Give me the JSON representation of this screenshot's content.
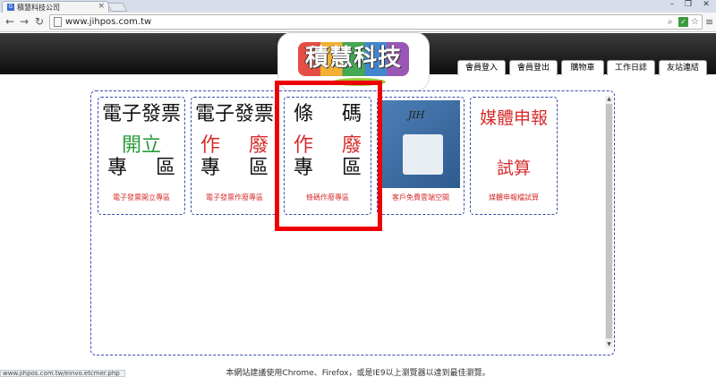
{
  "browser": {
    "tab_title": "積慧科技公司",
    "favicon": "G",
    "url": "www.jihpos.com.tw",
    "status_url": "www.jihpos.com.tw/einvo.etcmer.php"
  },
  "site": {
    "logo_text": "積慧科技",
    "nav": [
      "會員登入",
      "會員登出",
      "購物車",
      "工作日誌",
      "友站連結"
    ]
  },
  "cards": [
    {
      "lines": [
        [
          "電子發票"
        ],
        [
          "開立"
        ],
        [
          "專",
          "區"
        ]
      ],
      "caption": "電子發票開立專區"
    },
    {
      "lines": [
        [
          "電子發票"
        ],
        [
          "作",
          "廢"
        ],
        [
          "專",
          "區"
        ]
      ],
      "caption": "電子發票作廢專區"
    },
    {
      "lines": [
        [
          "條",
          "碼"
        ],
        [
          "作",
          "廢"
        ],
        [
          "專",
          "區"
        ]
      ],
      "caption": "條碼作廢專區"
    },
    {
      "image_brand": "JIH",
      "caption": "客戶免費雲端空間"
    },
    {
      "lines": [
        [
          "媒體申報"
        ],
        [
          "試算"
        ]
      ],
      "caption": "媒體申報檔試算"
    }
  ],
  "footer": "本網站建議使用Chrome、Firefox，或是IE9以上瀏覽器以達到最佳瀏覽。",
  "colors": {
    "highlight": "#ee0000",
    "card_border": "#3a4bb0",
    "caption": "#d62d2d",
    "green": "#2b9b3a"
  }
}
